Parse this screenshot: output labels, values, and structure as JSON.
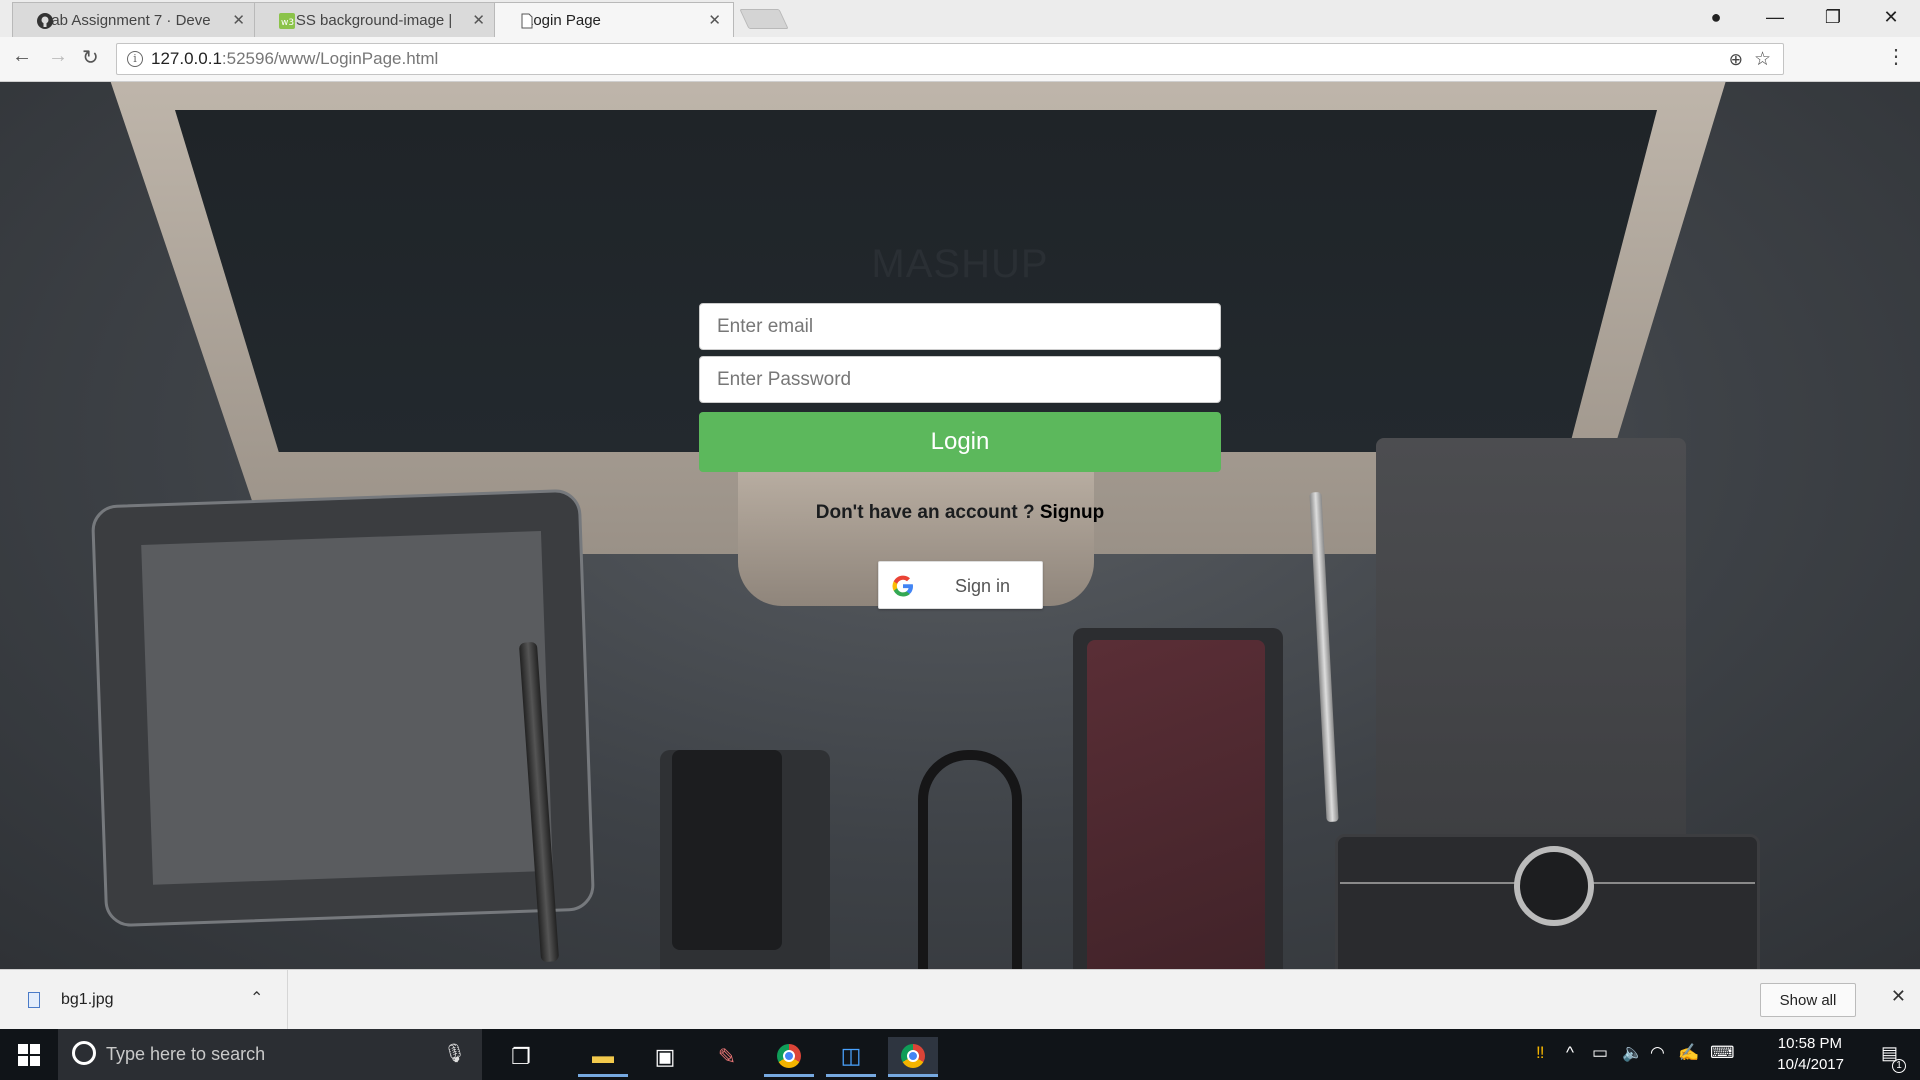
{
  "browser": {
    "tabs": [
      {
        "title": "Lab Assignment 7 · Deve",
        "icon": "github-icon"
      },
      {
        "title": "CSS background-image |",
        "icon": "w3schools-icon"
      },
      {
        "title": "Login Page",
        "icon": "page-icon"
      }
    ],
    "url": {
      "host": "127.0.0.1",
      "rest": ":52596/www/LoginPage.html"
    }
  },
  "page": {
    "brand": "MASHUP",
    "email_placeholder": "Enter email",
    "password_placeholder": "Enter Password",
    "login_label": "Login",
    "signup_prompt": "Don't have an account ? ",
    "signup_link": "Signup",
    "google_signin_label": "Sign in",
    "colors": {
      "login_button": "#5cb85c"
    }
  },
  "downloads": {
    "file_name": "bg1.jpg",
    "show_all_label": "Show all"
  },
  "taskbar": {
    "search_placeholder": "Type here to search",
    "time": "10:58 PM",
    "date": "10/4/2017",
    "notification_count": "1"
  }
}
